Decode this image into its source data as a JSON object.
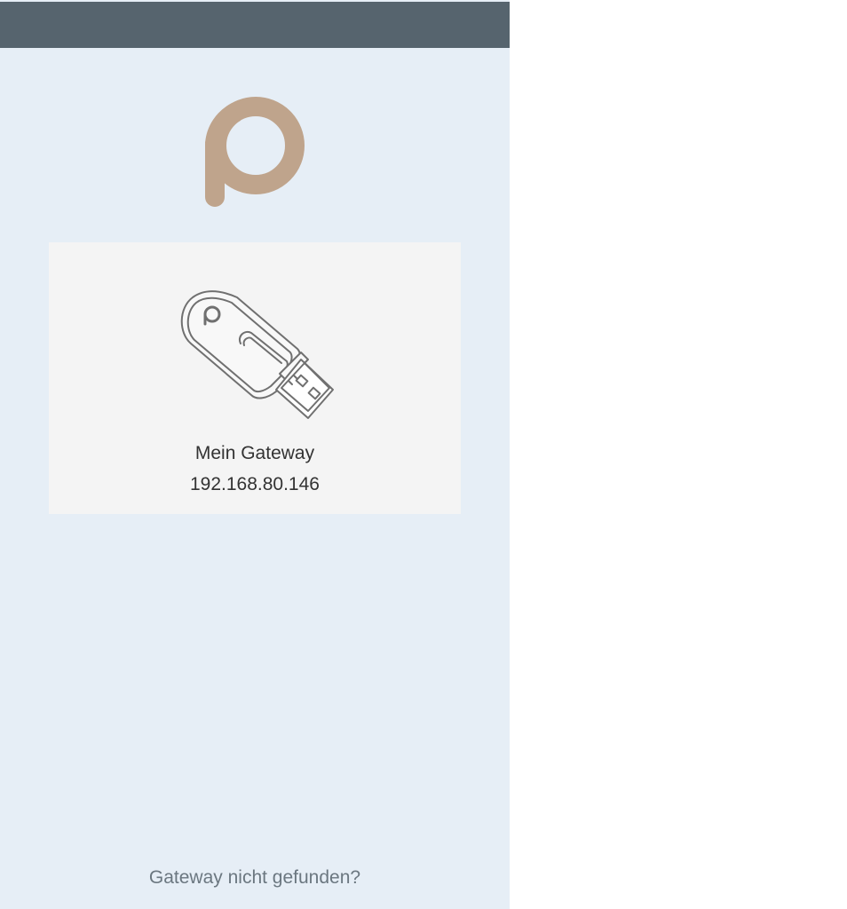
{
  "brand": {
    "logo_icon": "brand-logo-icon",
    "logo_color": "#bfa48c"
  },
  "header": {
    "background_color": "#56646e"
  },
  "gateway": {
    "icon": "usb-stick-icon",
    "name": "Mein Gateway",
    "ip": "192.168.80.146"
  },
  "footer": {
    "help_link": "Gateway nicht gefunden?"
  },
  "colors": {
    "panel_background": "#e6eef6",
    "card_background": "#f4f4f4"
  }
}
